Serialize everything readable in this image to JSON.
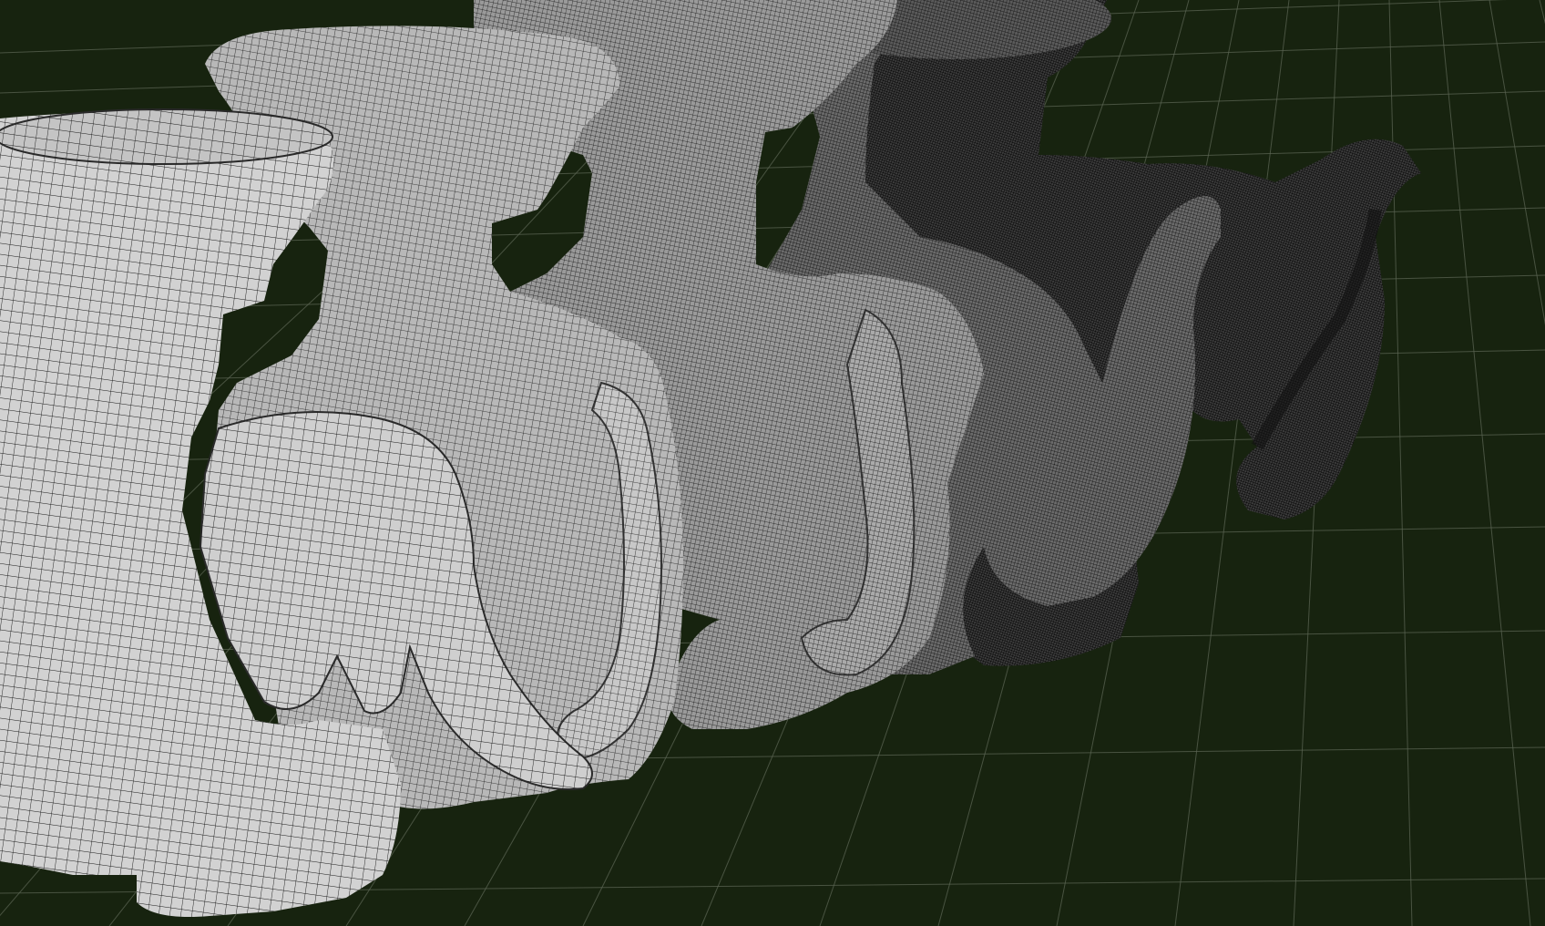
{
  "viewport": {
    "background_color": "#17230f",
    "grid_color": "#5a6452",
    "mesh_fill_colors": [
      "#d2d2d2",
      "#b8b8b8",
      "#9a9a9a",
      "#6e6e6e",
      "#3a3a3a"
    ],
    "wireframe_color": "#141414"
  },
  "models": [
    {
      "id": "mesh-lod-0",
      "shading": "light"
    },
    {
      "id": "mesh-lod-1",
      "shading": "light"
    },
    {
      "id": "mesh-lod-2",
      "shading": "mid"
    },
    {
      "id": "mesh-lod-3",
      "shading": "dark"
    },
    {
      "id": "mesh-lod-4",
      "shading": "darkest"
    }
  ]
}
